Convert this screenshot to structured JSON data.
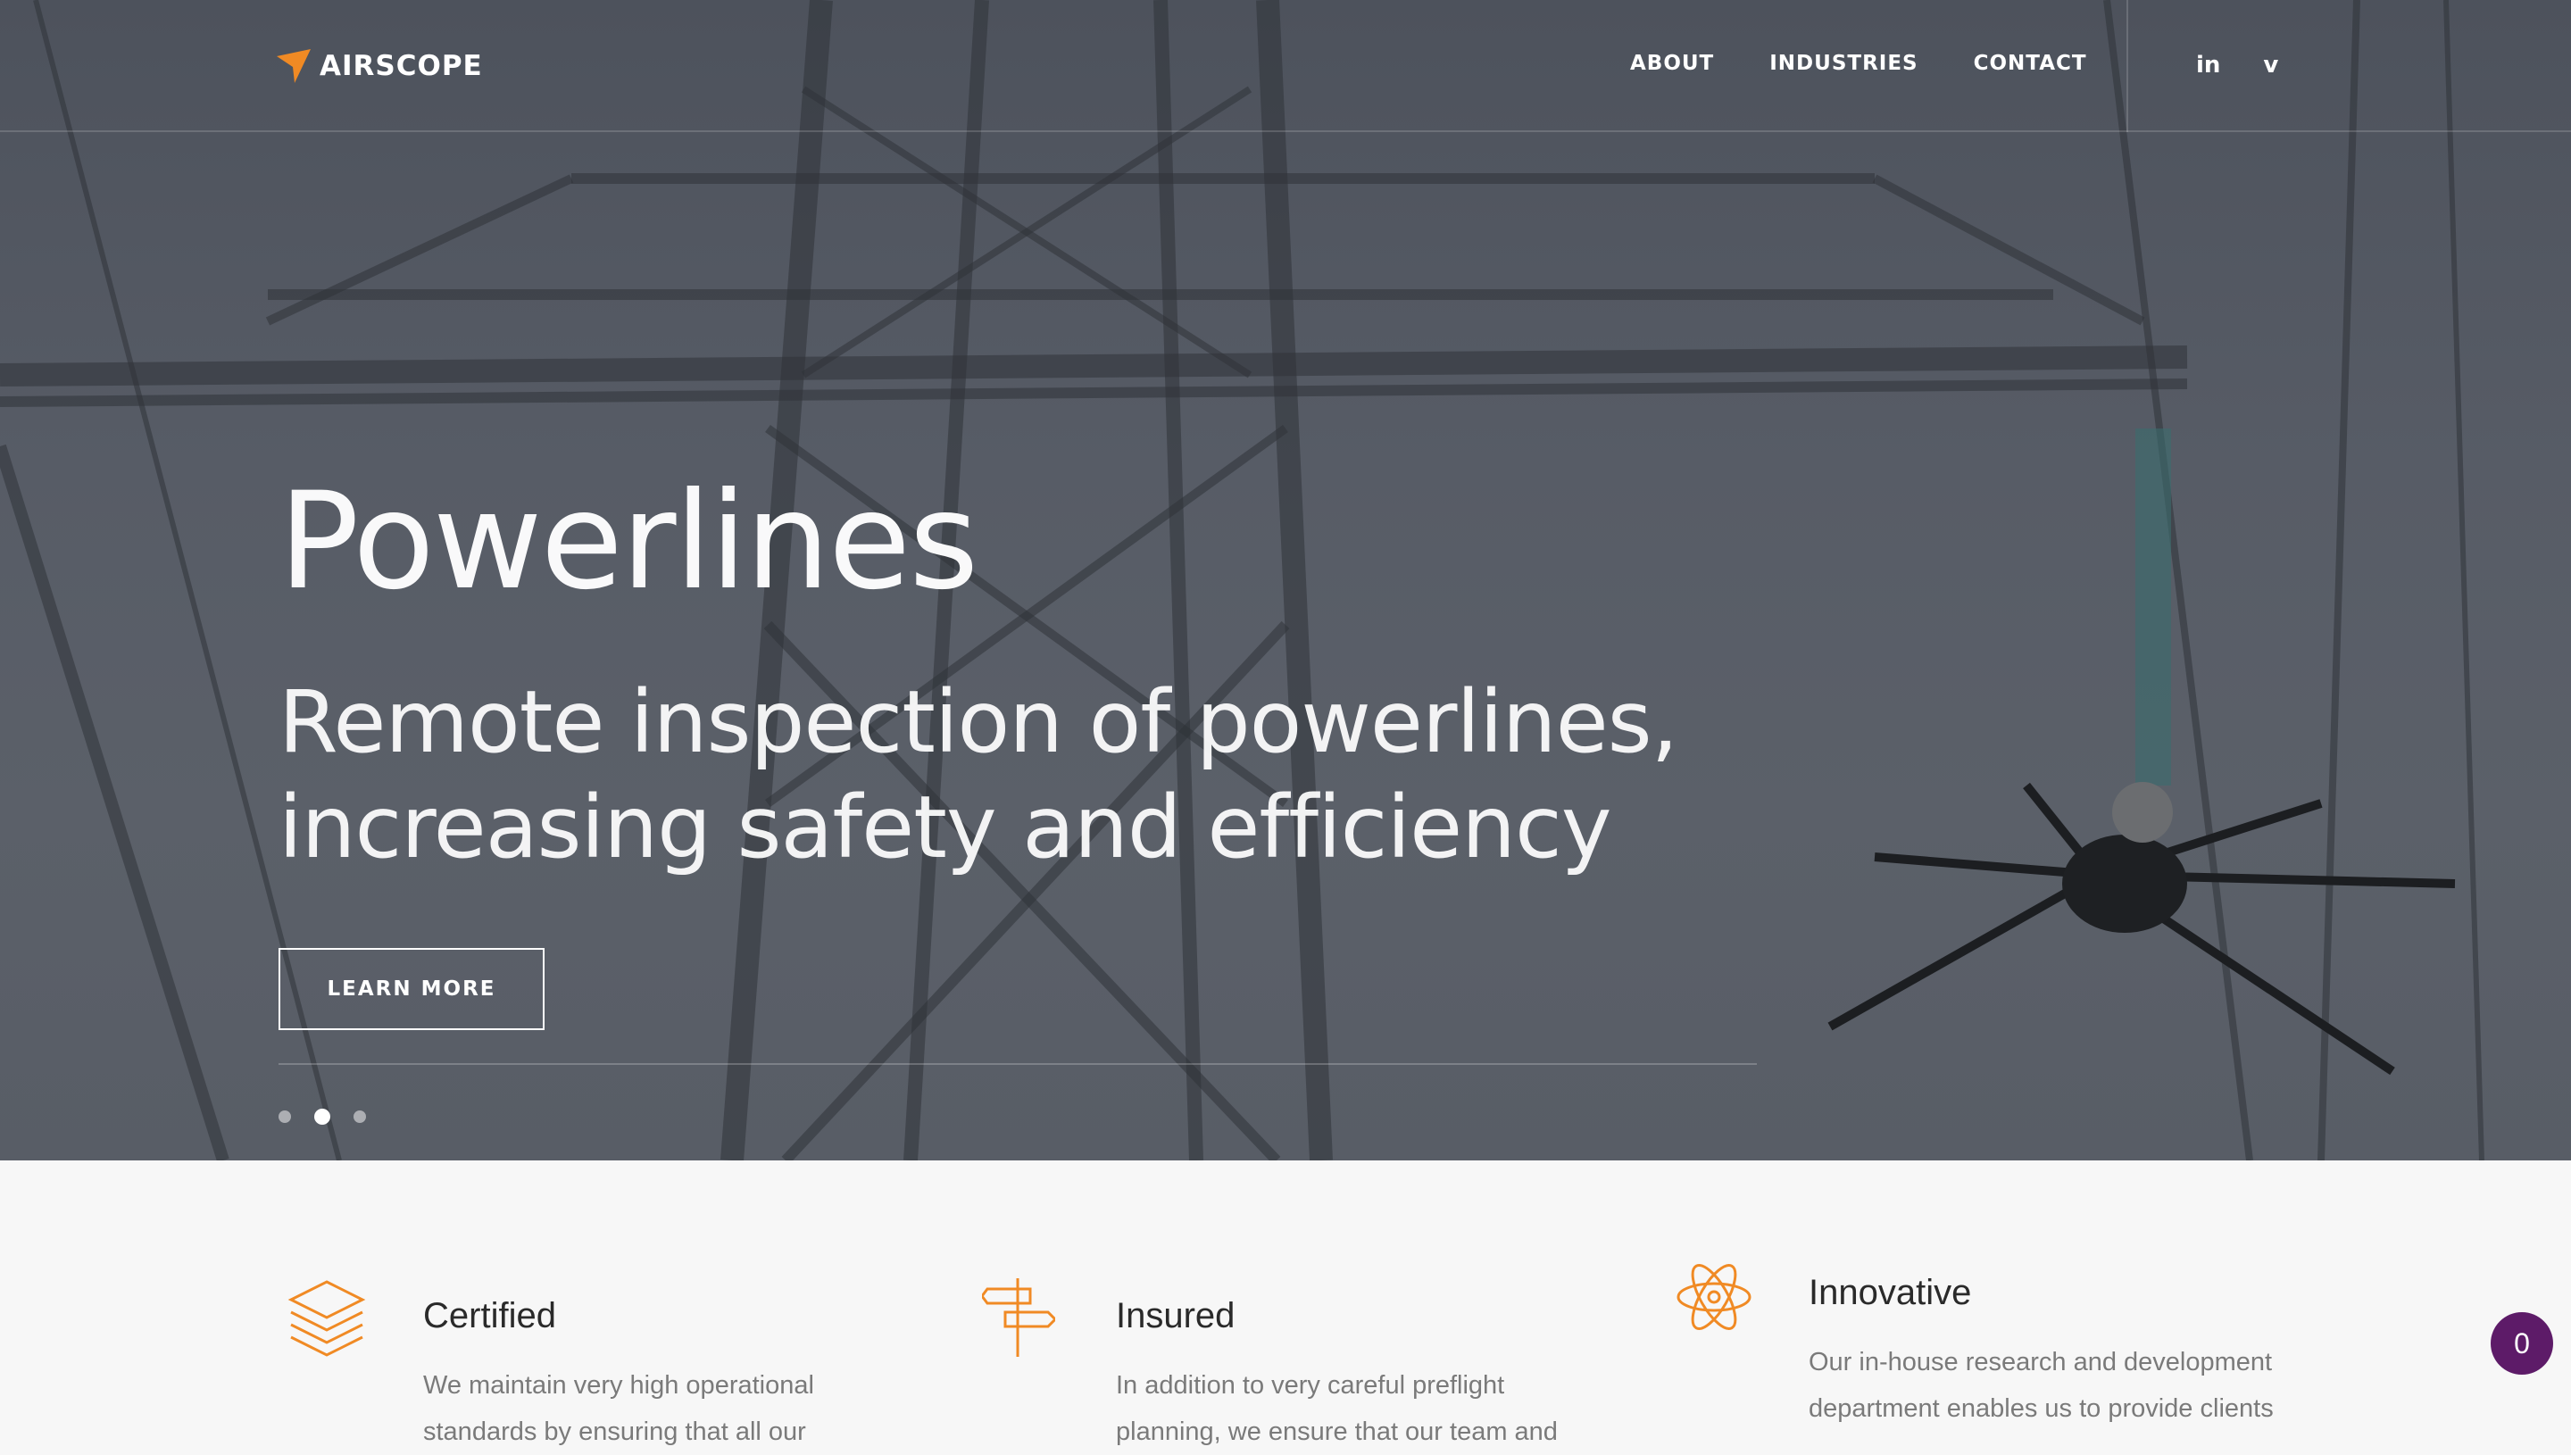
{
  "brand": {
    "name": "AIRSCOPE",
    "accent": "#f08a24"
  },
  "nav": {
    "items": [
      "ABOUT",
      "INDUSTRIES",
      "CONTACT"
    ]
  },
  "social": {
    "linkedin": "in",
    "vimeo": "v"
  },
  "hero": {
    "title": "Powerlines",
    "subtitle": "Remote inspection of powerlines, increasing safety and efficiency",
    "cta": "LEARN MORE",
    "slides_count": 3,
    "active_slide": 2
  },
  "features": [
    {
      "icon": "layers-icon",
      "title": "Certified",
      "text": "We maintain very high operational standards by ensuring that all our"
    },
    {
      "icon": "signpost-icon",
      "title": "Insured",
      "text": "In addition to very careful preflight planning, we ensure that our team and"
    },
    {
      "icon": "atom-icon",
      "title": "Innovative",
      "text": "Our in-house research and development department enables us to provide clients"
    }
  ],
  "chat": {
    "count": "0",
    "color": "#5d1b68"
  }
}
